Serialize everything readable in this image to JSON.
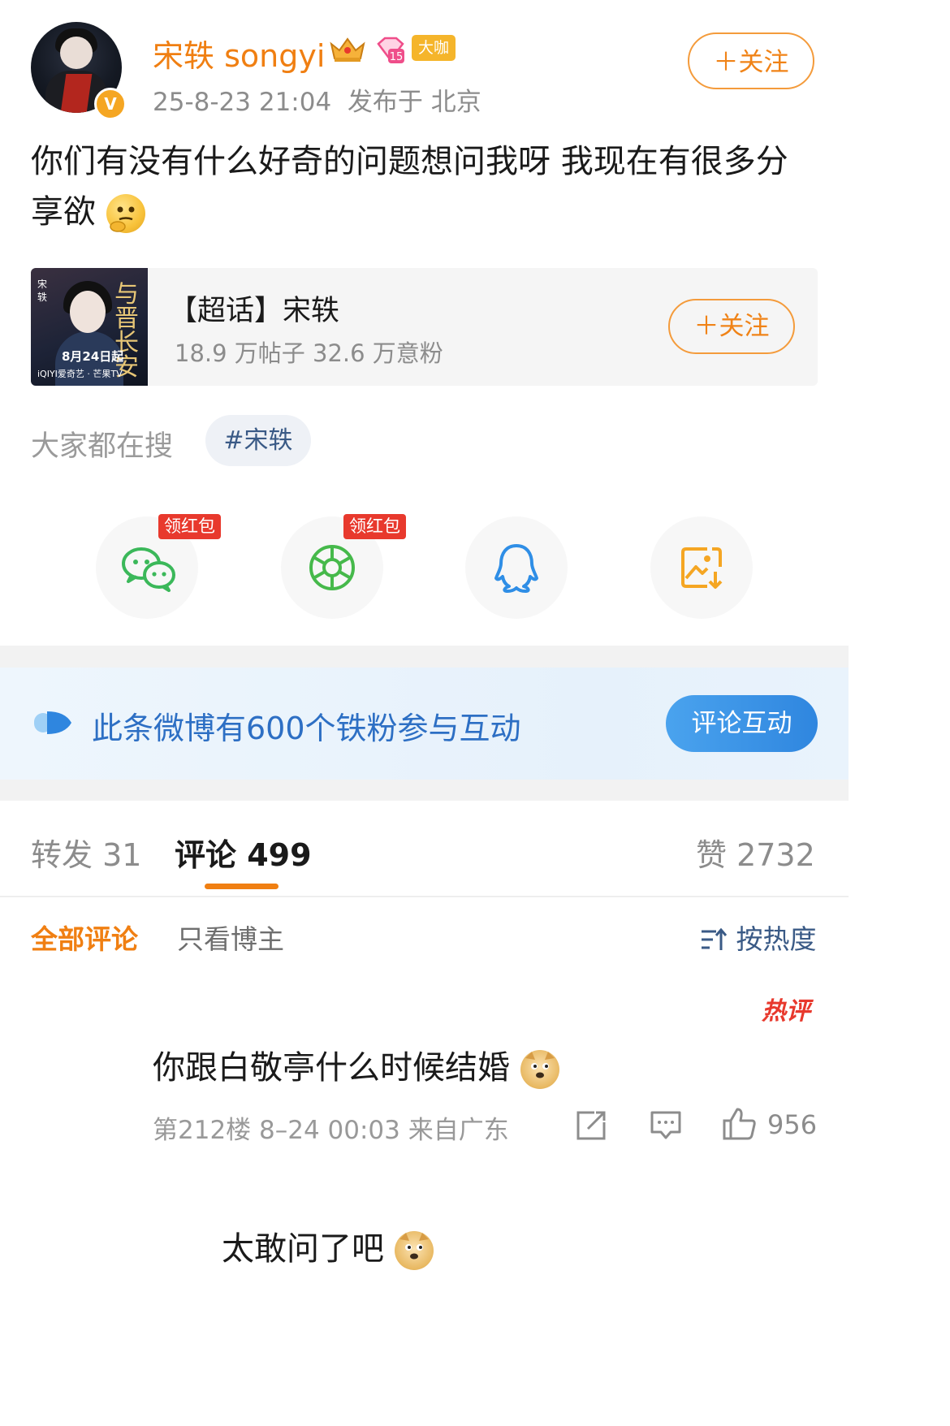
{
  "post": {
    "username": "宋轶 songyi",
    "badge_daka": "大咖",
    "gem_level": "15",
    "verified_mark": "V",
    "timestamp": "25-8-23 21:04",
    "location": "发布于 北京",
    "follow_label": "＋关注",
    "text": "你们有没有什么好奇的问题想问我呀 我现在有很多分享欲"
  },
  "topic_card": {
    "title": "【超话】宋轶",
    "stats": "18.9 万帖子  32.6 万意粉",
    "follow_label": "＋关注",
    "poster": {
      "title": "与晋长安",
      "date": "8月24日起",
      "side_text": "宋轶",
      "brand": "iQIYI爱奇艺 · 芒果TV"
    }
  },
  "search": {
    "label": "大家都在搜",
    "tag": "#宋轶"
  },
  "share": {
    "red_packet_label": "领红包",
    "targets": [
      {
        "icon": "wechat-icon",
        "color": "#3bb85a"
      },
      {
        "icon": "moments-icon",
        "color": "#46b94b"
      },
      {
        "icon": "qq-icon",
        "color": "#2f8ee6"
      },
      {
        "icon": "save-image-icon",
        "color": "#f5a623"
      }
    ]
  },
  "banner": {
    "text": "此条微博有600个铁粉参与互动",
    "button": "评论互动"
  },
  "tabs": {
    "repost": "转发 31",
    "comment": "评论 499",
    "likes": "赞 2732"
  },
  "filters": {
    "all": "全部评论",
    "owner_only": "只看博主",
    "sort": "按热度"
  },
  "comment": {
    "hot_tag": "热评",
    "text": "你跟白敬亭什么时候结婚",
    "meta": "第212楼  8–24 00:03  来自广东",
    "likes": "956"
  },
  "reply": {
    "text": "太敢问了吧"
  },
  "colors": {
    "accent_orange": "#f07f12",
    "link_blue": "#2d6fc4",
    "red": "#e8392d"
  }
}
